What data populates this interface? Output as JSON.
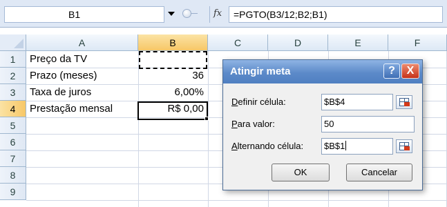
{
  "formula_bar": {
    "name_box": "B1",
    "fx_label": "fx",
    "formula": "=PGTO(B3/12;B2;B1)"
  },
  "sheet": {
    "columns": [
      "A",
      "B",
      "C",
      "D",
      "E",
      "F"
    ],
    "selected_column": "B",
    "rows": [
      "1",
      "2",
      "3",
      "4",
      "5",
      "6",
      "7",
      "8",
      "9"
    ],
    "selected_row": "4",
    "cells": {
      "A1": "Preço da TV",
      "A2": "Prazo (meses)",
      "A3": "Taxa de juros",
      "A4": "Prestação mensal",
      "B2": "36",
      "B3": "6,00%",
      "B4": "R$ 0,00"
    }
  },
  "dialog": {
    "title": "Atingir meta",
    "help_label": "?",
    "close_label": "X",
    "set_cell": {
      "accel": "D",
      "rest": "efinir célula:",
      "value": "$B$4"
    },
    "to_value": {
      "accel": "P",
      "rest": "ara valor:",
      "value": "50"
    },
    "changing_cell": {
      "accel": "A",
      "rest": "lternando célula:",
      "value": "$B$1"
    },
    "ok_label": "OK",
    "cancel_label": "Cancelar"
  },
  "colors": {
    "header_selected": "#f7c767",
    "dialog_title": "#5c8ac9",
    "close_button": "#c6321a"
  }
}
